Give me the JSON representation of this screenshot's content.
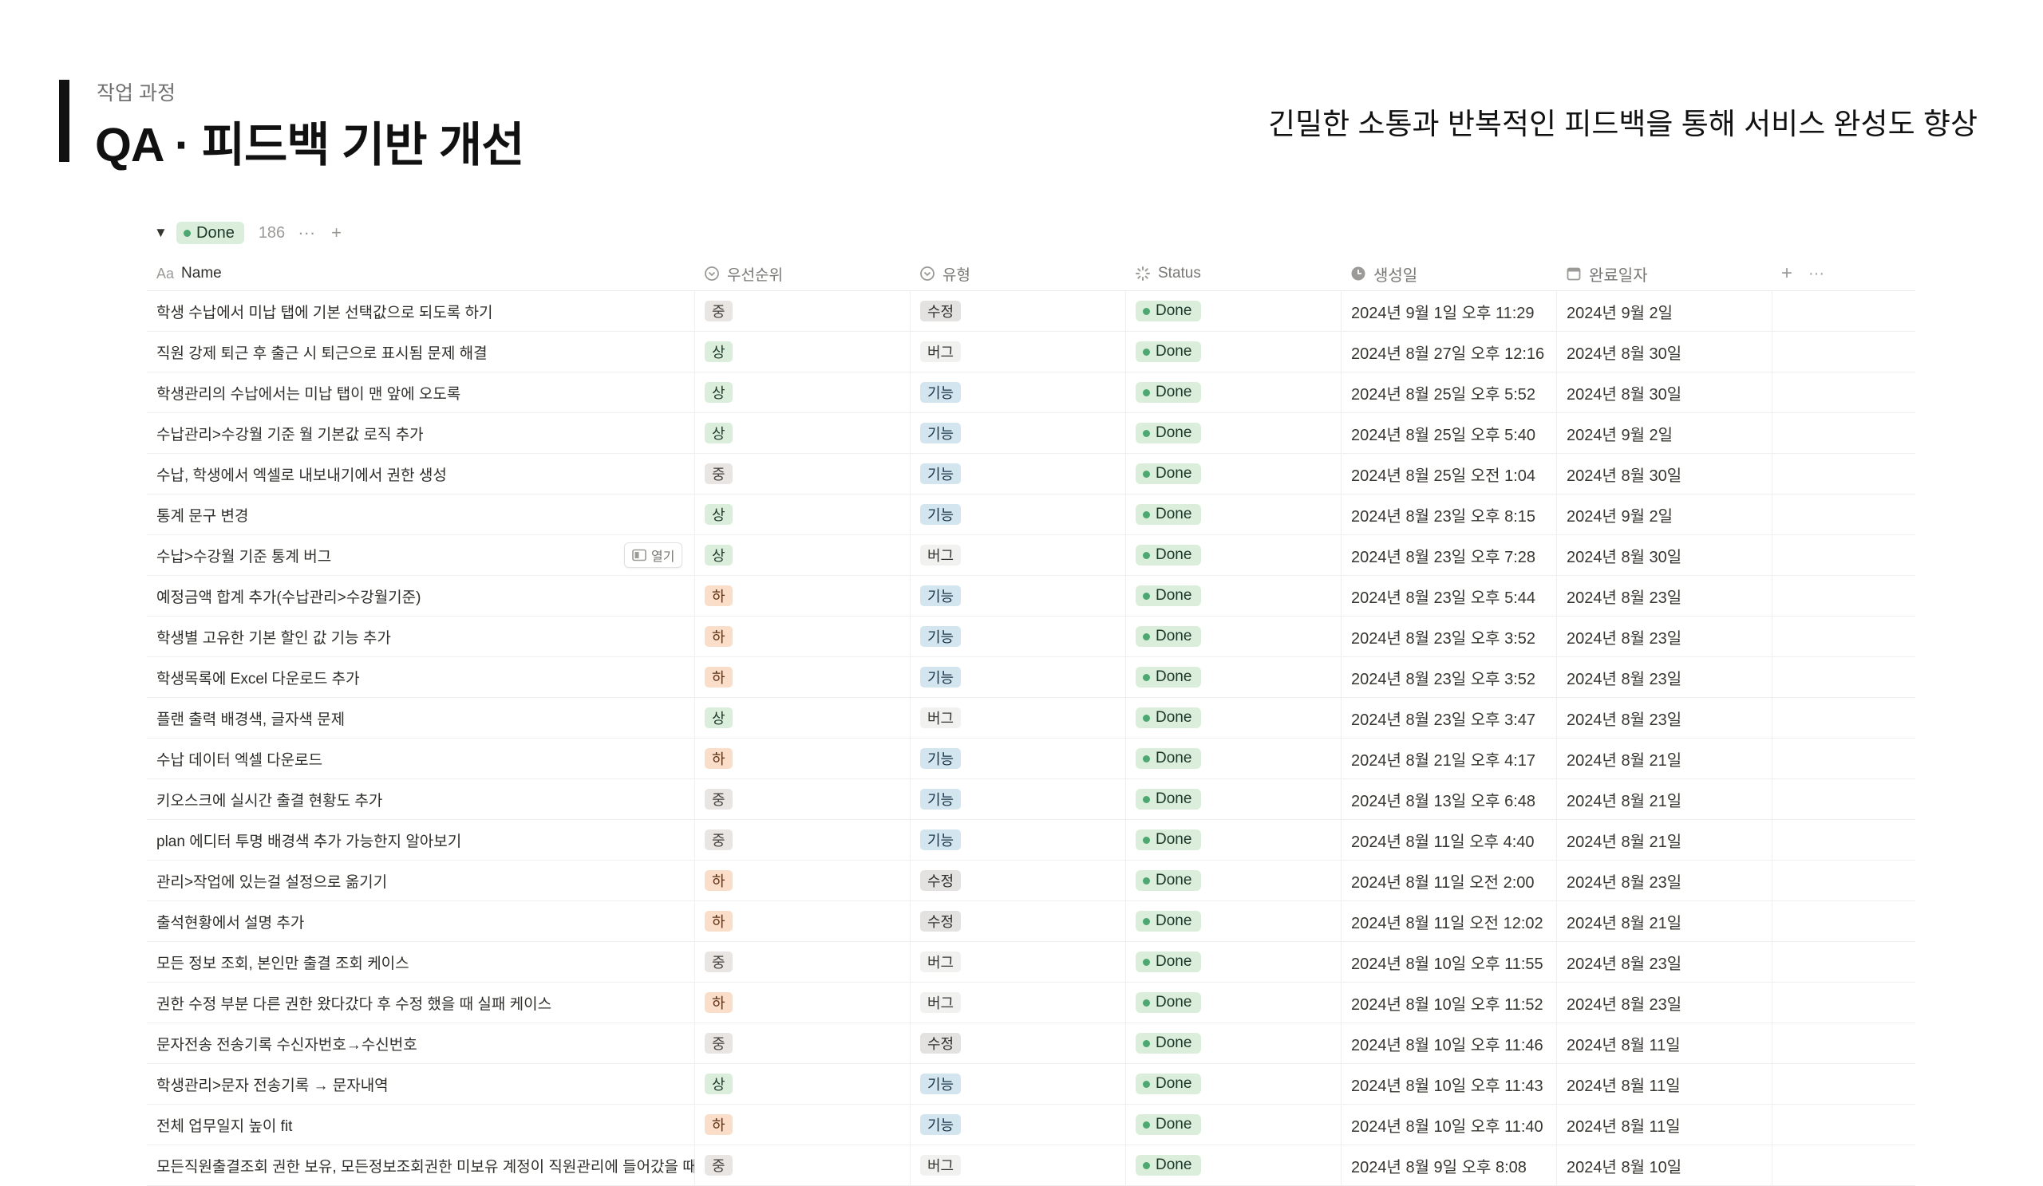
{
  "page": {
    "kicker": "작업 과정",
    "title": "QA · 피드백 기반 개선",
    "subtitle": "긴밀한 소통과 반복적인 피드백을 통해 서비스 완성도 향상"
  },
  "group": {
    "status": "Done",
    "count": "186",
    "more": "···",
    "add": "+"
  },
  "columns": {
    "name": "Name",
    "priority": "우선순위",
    "type": "유형",
    "status": "Status",
    "created": "생성일",
    "done": "완료일자",
    "add": "+",
    "more": "···"
  },
  "open_label": "열기",
  "colors": {
    "done_green": "#4ca870",
    "prio_high_bg": "#dbeddb",
    "prio_mid_bg": "#e9e5e3",
    "prio_low_bg": "#fadec9",
    "type_feature_bg": "#d3e5ef"
  },
  "rows": [
    {
      "name": "학생 수납에서 미납 탭에 기본 선택값으로 되도록 하기",
      "priority": "중",
      "type": "수정",
      "status": "Done",
      "created": "2024년 9월 1일 오후 11:29",
      "done": "2024년 9월 2일"
    },
    {
      "name": "직원 강제 퇴근 후 출근 시 퇴근으로 표시됨 문제 해결",
      "priority": "상",
      "type": "버그",
      "status": "Done",
      "created": "2024년 8월 27일 오후 12:16",
      "done": "2024년 8월 30일"
    },
    {
      "name": "학생관리의 수납에서는 미납 탭이 맨 앞에 오도록",
      "priority": "상",
      "type": "기능",
      "status": "Done",
      "created": "2024년 8월 25일 오후 5:52",
      "done": "2024년 8월 30일"
    },
    {
      "name": "수납관리>수강월 기준 월 기본값 로직 추가",
      "priority": "상",
      "type": "기능",
      "status": "Done",
      "created": "2024년 8월 25일 오후 5:40",
      "done": "2024년 9월 2일"
    },
    {
      "name": "수납, 학생에서 엑셀로 내보내기에서 권한 생성",
      "priority": "중",
      "type": "기능",
      "status": "Done",
      "created": "2024년 8월 25일 오전 1:04",
      "done": "2024년 8월 30일"
    },
    {
      "name": "통계 문구 변경",
      "priority": "상",
      "type": "기능",
      "status": "Done",
      "created": "2024년 8월 23일 오후 8:15",
      "done": "2024년 9월 2일"
    },
    {
      "name": "수납>수강월 기준 통계 버그",
      "priority": "상",
      "type": "버그",
      "status": "Done",
      "created": "2024년 8월 23일 오후 7:28",
      "done": "2024년 8월 30일",
      "hover": true
    },
    {
      "name": "예정금액 합계 추가(수납관리>수강월기준)",
      "priority": "하",
      "type": "기능",
      "status": "Done",
      "created": "2024년 8월 23일 오후 5:44",
      "done": "2024년 8월 23일"
    },
    {
      "name": "학생별 고유한 기본 할인 값 기능 추가",
      "priority": "하",
      "type": "기능",
      "status": "Done",
      "created": "2024년 8월 23일 오후 3:52",
      "done": "2024년 8월 23일"
    },
    {
      "name": "학생목록에 Excel 다운로드 추가",
      "priority": "하",
      "type": "기능",
      "status": "Done",
      "created": "2024년 8월 23일 오후 3:52",
      "done": "2024년 8월 23일"
    },
    {
      "name": "플랜 출력 배경색, 글자색 문제",
      "priority": "상",
      "type": "버그",
      "status": "Done",
      "created": "2024년 8월 23일 오후 3:47",
      "done": "2024년 8월 23일"
    },
    {
      "name": "수납 데이터 엑셀 다운로드",
      "priority": "하",
      "type": "기능",
      "status": "Done",
      "created": "2024년 8월 21일 오후 4:17",
      "done": "2024년 8월 21일"
    },
    {
      "name": "키오스크에 실시간 출결 현황도 추가",
      "priority": "중",
      "type": "기능",
      "status": "Done",
      "created": "2024년 8월 13일 오후 6:48",
      "done": "2024년 8월 21일"
    },
    {
      "name": "plan 에디터 투명 배경색 추가 가능한지 알아보기",
      "priority": "중",
      "type": "기능",
      "status": "Done",
      "created": "2024년 8월 11일 오후 4:40",
      "done": "2024년 8월 21일"
    },
    {
      "name": "관리>작업에 있는걸 설정으로 옮기기",
      "priority": "하",
      "type": "수정",
      "status": "Done",
      "created": "2024년 8월 11일 오전 2:00",
      "done": "2024년 8월 23일"
    },
    {
      "name": "출석현황에서 설명 추가",
      "priority": "하",
      "type": "수정",
      "status": "Done",
      "created": "2024년 8월 11일 오전 12:02",
      "done": "2024년 8월 21일"
    },
    {
      "name": "모든 정보 조회, 본인만 출결 조회 케이스",
      "priority": "중",
      "type": "버그",
      "status": "Done",
      "created": "2024년 8월 10일 오후 11:55",
      "done": "2024년 8월 23일"
    },
    {
      "name": "권한 수정 부분 다른 권한 왔다갔다 후 수정 했을 때 실패 케이스",
      "priority": "하",
      "type": "버그",
      "status": "Done",
      "created": "2024년 8월 10일 오후 11:52",
      "done": "2024년 8월 23일"
    },
    {
      "name": "문자전송 전송기록 수신자번호→수신번호",
      "priority": "중",
      "type": "수정",
      "status": "Done",
      "created": "2024년 8월 10일 오후 11:46",
      "done": "2024년 8월 11일"
    },
    {
      "name": "학생관리>문자 전송기록 → 문자내역",
      "priority": "상",
      "type": "기능",
      "status": "Done",
      "created": "2024년 8월 10일 오후 11:43",
      "done": "2024년 8월 11일"
    },
    {
      "name": "전체 업무일지 높이 fit",
      "priority": "하",
      "type": "기능",
      "status": "Done",
      "created": "2024년 8월 10일 오후 11:40",
      "done": "2024년 8월 11일"
    },
    {
      "name": "모든직원출결조회 권한 보유, 모든정보조회권한 미보유 계정이 직원관리에 들어갔을 때 문",
      "priority": "중",
      "type": "버그",
      "status": "Done",
      "created": "2024년 8월 9일 오후 8:08",
      "done": "2024년 8월 10일"
    }
  ]
}
